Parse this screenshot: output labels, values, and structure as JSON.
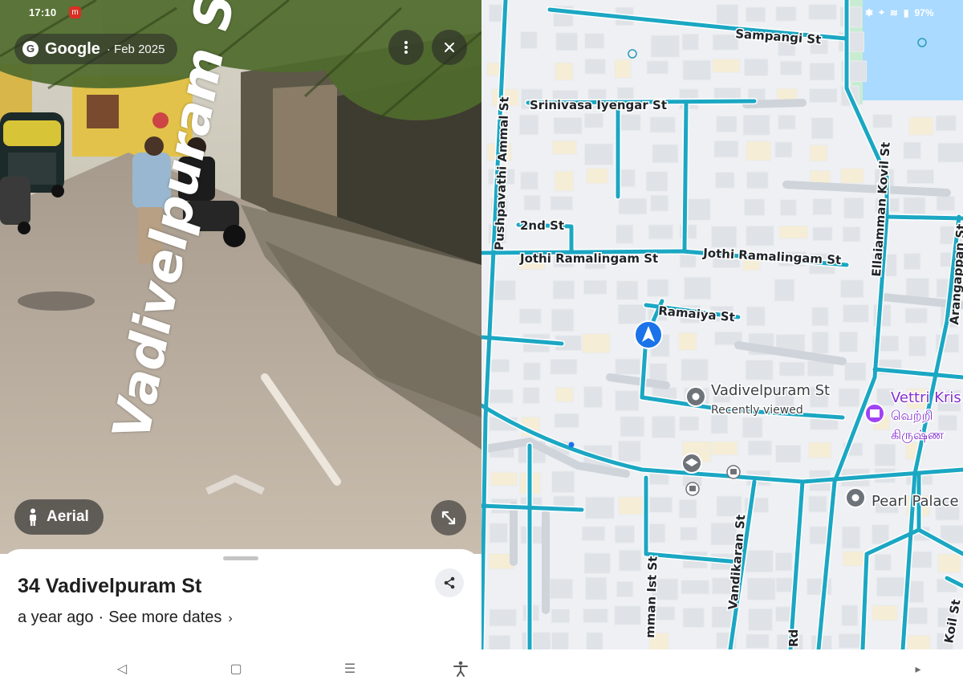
{
  "status": {
    "time": "17:10",
    "app_badge": "m",
    "battery": "97%"
  },
  "streetview": {
    "brand": "Google",
    "date": "· Feb 2025",
    "street_label": "Vadivelpuram St",
    "aerial_label": "Aerial",
    "icons": {
      "logo": "google-g-icon",
      "menu": "more-vert-icon",
      "close": "close-icon",
      "person": "person-icon",
      "expand": "expand-icon",
      "navigate": "chevron-up-icon"
    }
  },
  "sheet": {
    "address": "34 Vadivelpuram St",
    "age": "a year ago",
    "separator": "·",
    "more_dates": "See more dates",
    "chevron": "›"
  },
  "map": {
    "streets": [
      "Sampangi St",
      "Srinivasa Iyengar St",
      "Pushpavathi Ammal St",
      "2nd St",
      "Jothi Ramalingam St",
      "Jothi Ramalingam St",
      "Ellaiamman Kovil St",
      "Arangappan St",
      "Ramaiya St",
      "mman Ist St",
      "Vandikaran St",
      "Rd",
      "Koil St"
    ],
    "place": {
      "name": "Vadivelpuram St",
      "subtitle": "Recently viewed"
    },
    "vettri": {
      "name": "Vettri Kris",
      "tamil1": "வெற்றி",
      "tamil2": "கிருஷ்ண"
    },
    "pearl": {
      "name": "Pearl Palace"
    },
    "colors": {
      "road": "#1ba7c3",
      "road_casing": "#ffffff",
      "block": "#dfe2e7",
      "water": "#aadaff",
      "park": "#c8ecd2",
      "pin": "#6e7379",
      "location": "#1a73e8"
    }
  },
  "navbar": {
    "back": "◁",
    "home": "▢",
    "recents": "☰",
    "accessibility": "accessibility-icon",
    "more": "▸"
  }
}
